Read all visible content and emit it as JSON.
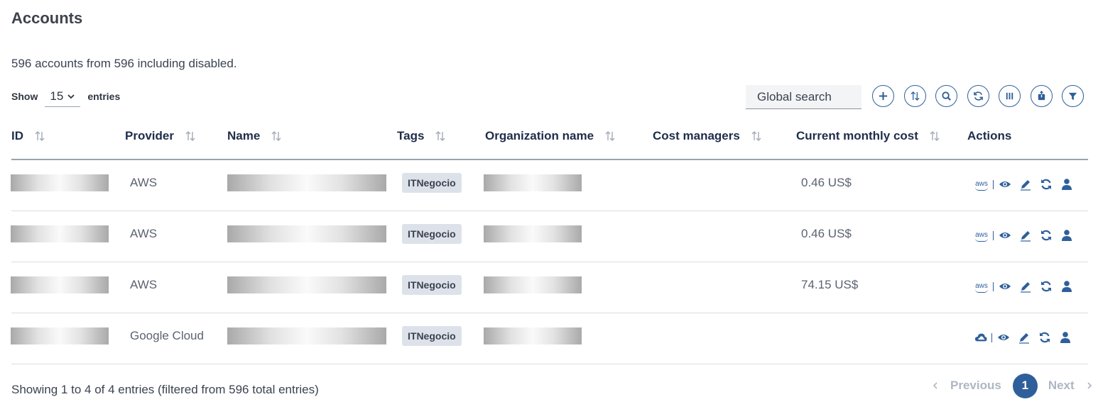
{
  "page": {
    "title": "Accounts",
    "summary": "596 accounts from 596 including disabled."
  },
  "length": {
    "show_label": "Show",
    "value": "15",
    "entries_label": "entries"
  },
  "search": {
    "placeholder": "Global search"
  },
  "toolbar": [
    {
      "name": "add-icon"
    },
    {
      "name": "sort-icon"
    },
    {
      "name": "search-icon"
    },
    {
      "name": "refresh-icon"
    },
    {
      "name": "columns-icon"
    },
    {
      "name": "export-icon"
    },
    {
      "name": "filter-icon"
    }
  ],
  "columns": [
    {
      "label": "ID"
    },
    {
      "label": "Provider"
    },
    {
      "label": "Name"
    },
    {
      "label": "Tags"
    },
    {
      "label": "Organization name"
    },
    {
      "label": "Cost managers"
    },
    {
      "label": "Current monthly cost"
    },
    {
      "label": "Actions"
    }
  ],
  "rows": [
    {
      "provider": "AWS",
      "tag": "ITNegocio",
      "cost": "0.46 US$",
      "provider_icon": "aws-icon"
    },
    {
      "provider": "AWS",
      "tag": "ITNegocio",
      "cost": "0.46 US$",
      "provider_icon": "aws-icon"
    },
    {
      "provider": "AWS",
      "tag": "ITNegocio",
      "cost": "74.15 US$",
      "provider_icon": "aws-icon"
    },
    {
      "provider": "Google Cloud",
      "tag": "ITNegocio",
      "cost": "",
      "provider_icon": "cloud-icon"
    }
  ],
  "aws_logo_text": "aws",
  "footer": {
    "info": "Showing 1 to 4 of 4 entries (filtered from 596 total entries)",
    "prev_label": "Previous",
    "page": "1",
    "next_label": "Next"
  },
  "colors": {
    "accent": "#2e5f9b",
    "header_text": "#1f2d4a",
    "tag_bg": "#dde2ea"
  }
}
